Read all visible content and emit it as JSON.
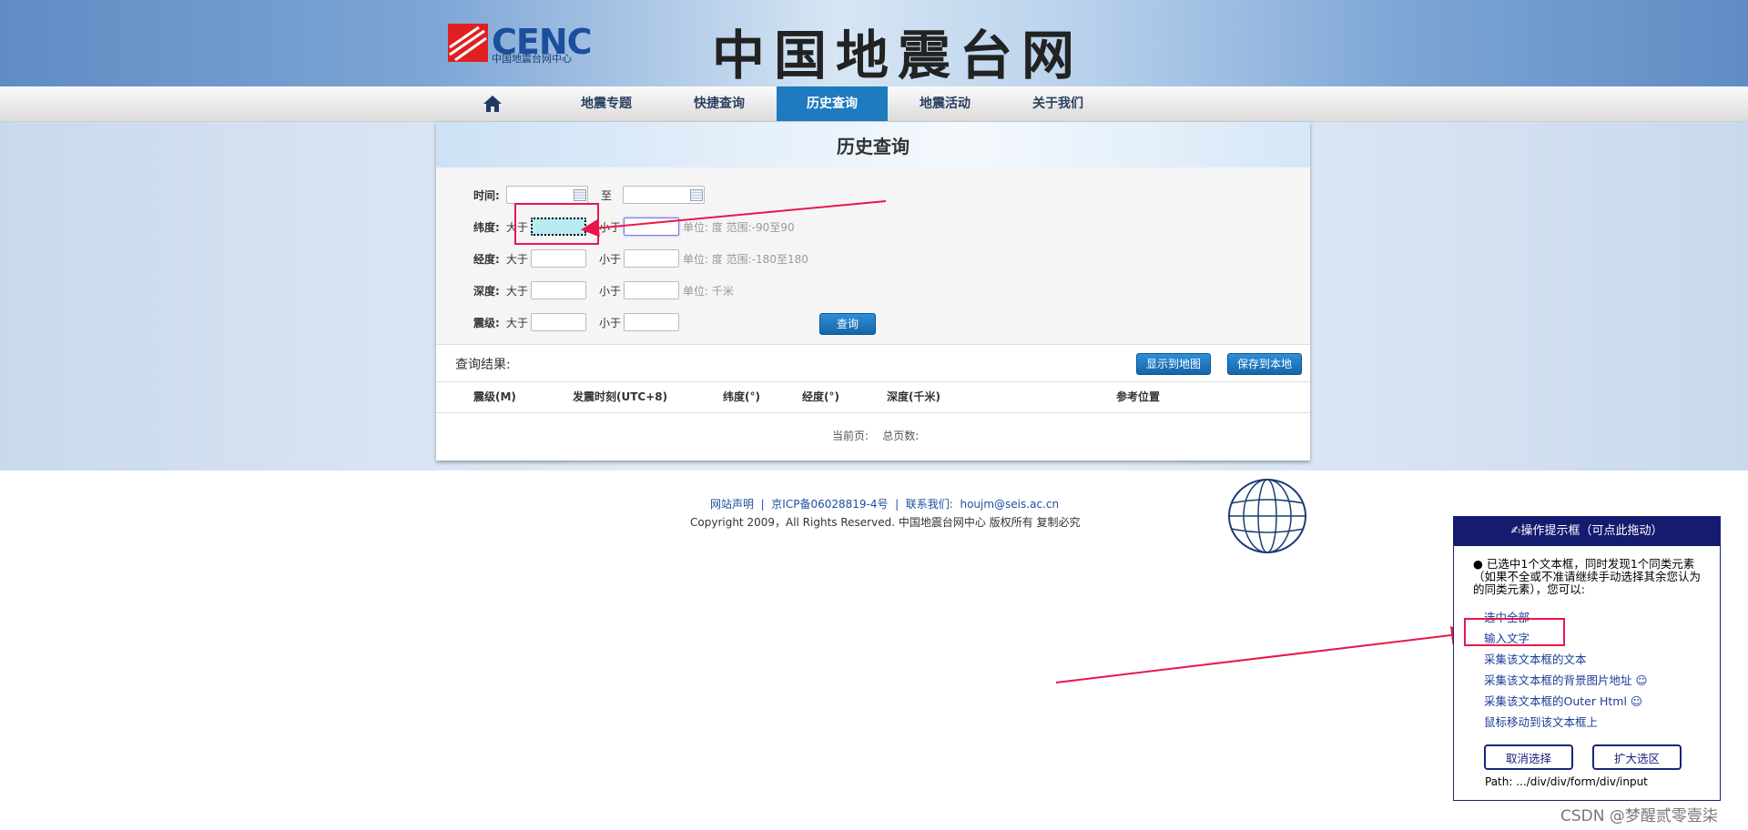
{
  "header": {
    "logo_text": "CENC",
    "logo_sub": "中国地震台网中心",
    "site_title": "中国地震台网"
  },
  "nav": {
    "home_icon": "home-icon",
    "items": [
      "地震专题",
      "快捷查询",
      "历史查询",
      "地震活动",
      "关于我们"
    ],
    "active": "历史查询"
  },
  "panel": {
    "title": "历史查询",
    "time_label": "时间:",
    "to_label": "至",
    "gt": "大于",
    "lt": "小于",
    "rows": [
      {
        "label": "纬度:",
        "unit": "单位: 度 范围:-90至90"
      },
      {
        "label": "经度:",
        "unit": "单位: 度 范围:-180至180"
      },
      {
        "label": "深度:",
        "unit": "单位: 千米"
      },
      {
        "label": "震级:",
        "unit": ""
      }
    ],
    "query_button": "查询"
  },
  "results": {
    "label": "查询结果:",
    "show_map_button": "显示到地图",
    "save_local_button": "保存到本地",
    "columns": [
      "震级(M)",
      "发震时刻(UTC+8)",
      "纬度(°)",
      "经度(°)",
      "深度(千米)",
      "参考位置"
    ],
    "pager": "当前页:    总页数:"
  },
  "footer": {
    "links": "网站声明  |  京ICP备06028819-4号  |  联系我们:  houjm@seis.ac.cn",
    "copyright": "Copyright 2009，All Rights Reserved. 中国地震台网中心 版权所有 复制必究"
  },
  "popup": {
    "title": "✍操作提示框（可点此拖动）",
    "message": "● 已选中1个文本框，同时发现1个同类元素（如果不全或不准请继续手动选择其余您认为的同类元素），您可以:",
    "links": [
      "选中全部",
      "输入文字",
      "采集该文本框的文本",
      "采集该文本框的背景图片地址 ☺",
      "采集该文本框的Outer Html ☺",
      "鼠标移动到该文本框上"
    ],
    "cancel_button": "取消选择",
    "expand_button": "扩大选区",
    "path": "Path: .../div/div/form/div/input"
  },
  "watermark": "CSDN @梦醒贰零壹柒",
  "colors": {
    "accent_blue": "#1e7bc0",
    "annotation_red": "#e8174a",
    "popup_navy": "#151b6e"
  }
}
